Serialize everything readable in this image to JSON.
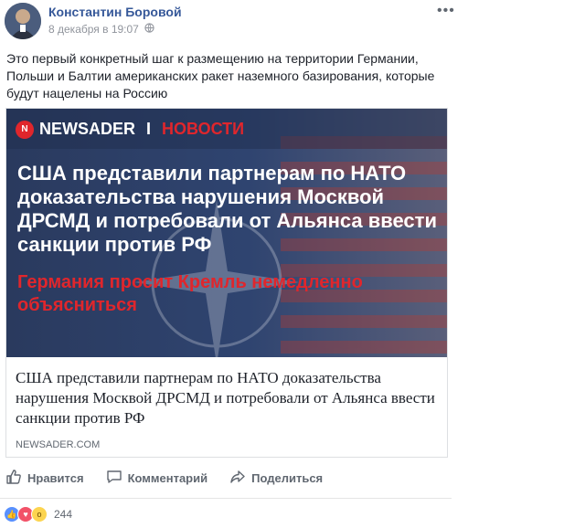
{
  "post": {
    "author": "Константин Боровой",
    "date": "8 декабря в 19:07",
    "privacy_icon": "globe-icon",
    "text": "Это первый конкретный шаг к размещению на территории Германии, Польши и Балтии американских ракет наземного базирования, которые будут нацелены на Россию",
    "more_label": "•••"
  },
  "card": {
    "brand_logo": "N",
    "brand_name": "NEWSADER",
    "brand_sep": "I",
    "brand_section": "НОВОСТИ",
    "headline": "США представили партнерам по НАТО доказательства нарушения Москвой ДРСМД и потребовали от Альянса ввести санкции против РФ",
    "subhead": "Германия просит Кремль немедленно объясниться",
    "title": "США представили партнерам по НАТО доказательства нарушения Москвой ДРСМД и потребовали от Альянса ввести санкции против РФ",
    "domain": "NEWSADER.COM"
  },
  "actions": {
    "like": "Нравится",
    "comment": "Комментарий",
    "share": "Поделиться"
  },
  "reactions": {
    "count": "244",
    "types": [
      "like-icon",
      "love-icon",
      "wow-icon"
    ],
    "colors": {
      "like": "#5890ff",
      "love": "#f25268",
      "wow": "#fcd44f"
    }
  },
  "colors": {
    "author_link": "#365899",
    "brand_red": "#e0262c"
  }
}
